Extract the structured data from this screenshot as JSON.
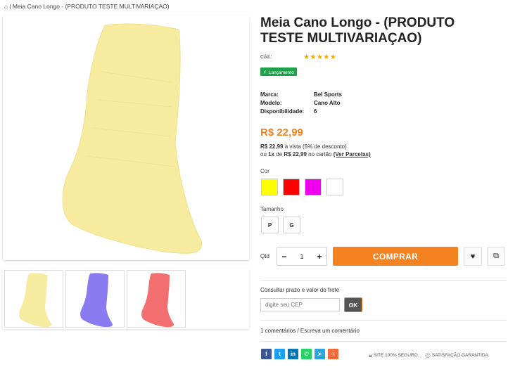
{
  "breadcrumb": {
    "home_icon": "home-icon",
    "separator": "|",
    "current": "Meia Cano Longo - (PRODUTO TESTE MULTIVARIAÇAO)"
  },
  "product": {
    "title": "Meia Cano Longo - (PRODUTO TESTE MULTIVARIAÇAO)",
    "cod_label": "Cód.:",
    "rating_stars": 5,
    "badge": "Lançamento",
    "specs": [
      {
        "label": "Marca:",
        "value": "Bel Sports"
      },
      {
        "label": "Modelo:",
        "value": "Cano Alto"
      },
      {
        "label": "Disponibilidade:",
        "value": "6"
      }
    ],
    "price": "R$ 22,99",
    "cash_price": "R$ 22,99",
    "cash_text": "à vista (5% de desconto)",
    "installment_prefix": "ou",
    "installment_qty": "1x",
    "installment_de": "de",
    "installment_price": "R$ 22,99",
    "installment_suffix": "no cartão",
    "installments_link": "(Ver Parcelas)"
  },
  "variations": {
    "color_label": "Cor",
    "colors": [
      "#ffff00",
      "#ff0000",
      "#ee00ee",
      "#ffffff"
    ],
    "size_label": "Tamanho",
    "sizes": [
      "P",
      "G"
    ]
  },
  "purchase": {
    "qty_label": "Qtd",
    "qty_value": "1",
    "minus": "−",
    "plus": "+",
    "buy_label": "COMPRAR",
    "accent": "#f58220"
  },
  "shipping": {
    "label": "Consultar prazo e valor do frete",
    "cep_placeholder": "digite seu CEP",
    "ok_label": "OK"
  },
  "comments": {
    "text": "1 comentários / Escreva um comentário"
  },
  "share": [
    {
      "icon": "facebook-icon",
      "glyph": "f",
      "color": "#3b5998"
    },
    {
      "icon": "twitter-icon",
      "glyph": "t",
      "color": "#1da1f2"
    },
    {
      "icon": "linkedin-icon",
      "glyph": "in",
      "color": "#0077b5"
    },
    {
      "icon": "whatsapp-icon",
      "glyph": "✆",
      "color": "#25d366"
    },
    {
      "icon": "telegram-icon",
      "glyph": "➤",
      "color": "#2ca5e0"
    },
    {
      "icon": "more-icon",
      "glyph": "+",
      "color": "#f26a3d"
    }
  ],
  "trust": {
    "secure": "SITE 100% SEGURO.",
    "satisfaction": "SATISFAÇÃO GARANTIDA."
  },
  "gallery": {
    "sock_colors": [
      "#f7eba0",
      "#8a7cf0",
      "#f36f6f"
    ]
  }
}
